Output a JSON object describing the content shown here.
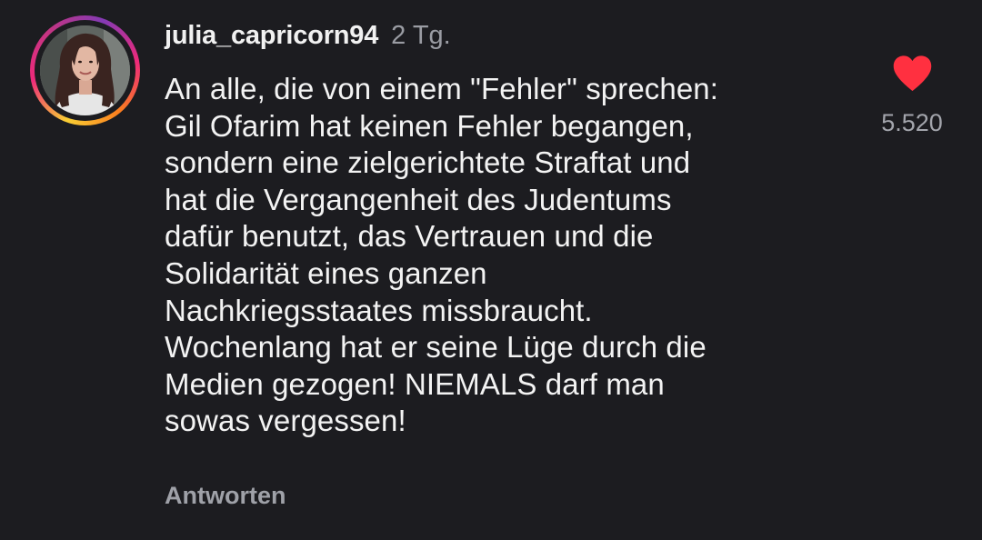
{
  "comment": {
    "username": "julia_capricorn94",
    "time": "2 Tg.",
    "text": "An alle, die von einem \"Fehler\" sprechen:\nGil Ofarim hat keinen Fehler begangen,\nsondern eine zielgerichtete Straftat und\nhat die Vergangenheit des Judentums\ndafür benutzt, das Vertrauen und die\nSolidarität eines ganzen\nNachkriegsstaates missbraucht.\nWochenlang hat er seine Lüge durch die\nMedien gezogen! NIEMALS darf man\nsowas vergessen!",
    "reply_label": "Antworten",
    "likes": "5.520",
    "like_icon": "heart-icon",
    "like_color": "#ff3040",
    "story_ring_colors": [
      "#f9ce34",
      "#ee2a7b",
      "#c13584",
      "#833ab4",
      "#fa7e1e"
    ]
  }
}
